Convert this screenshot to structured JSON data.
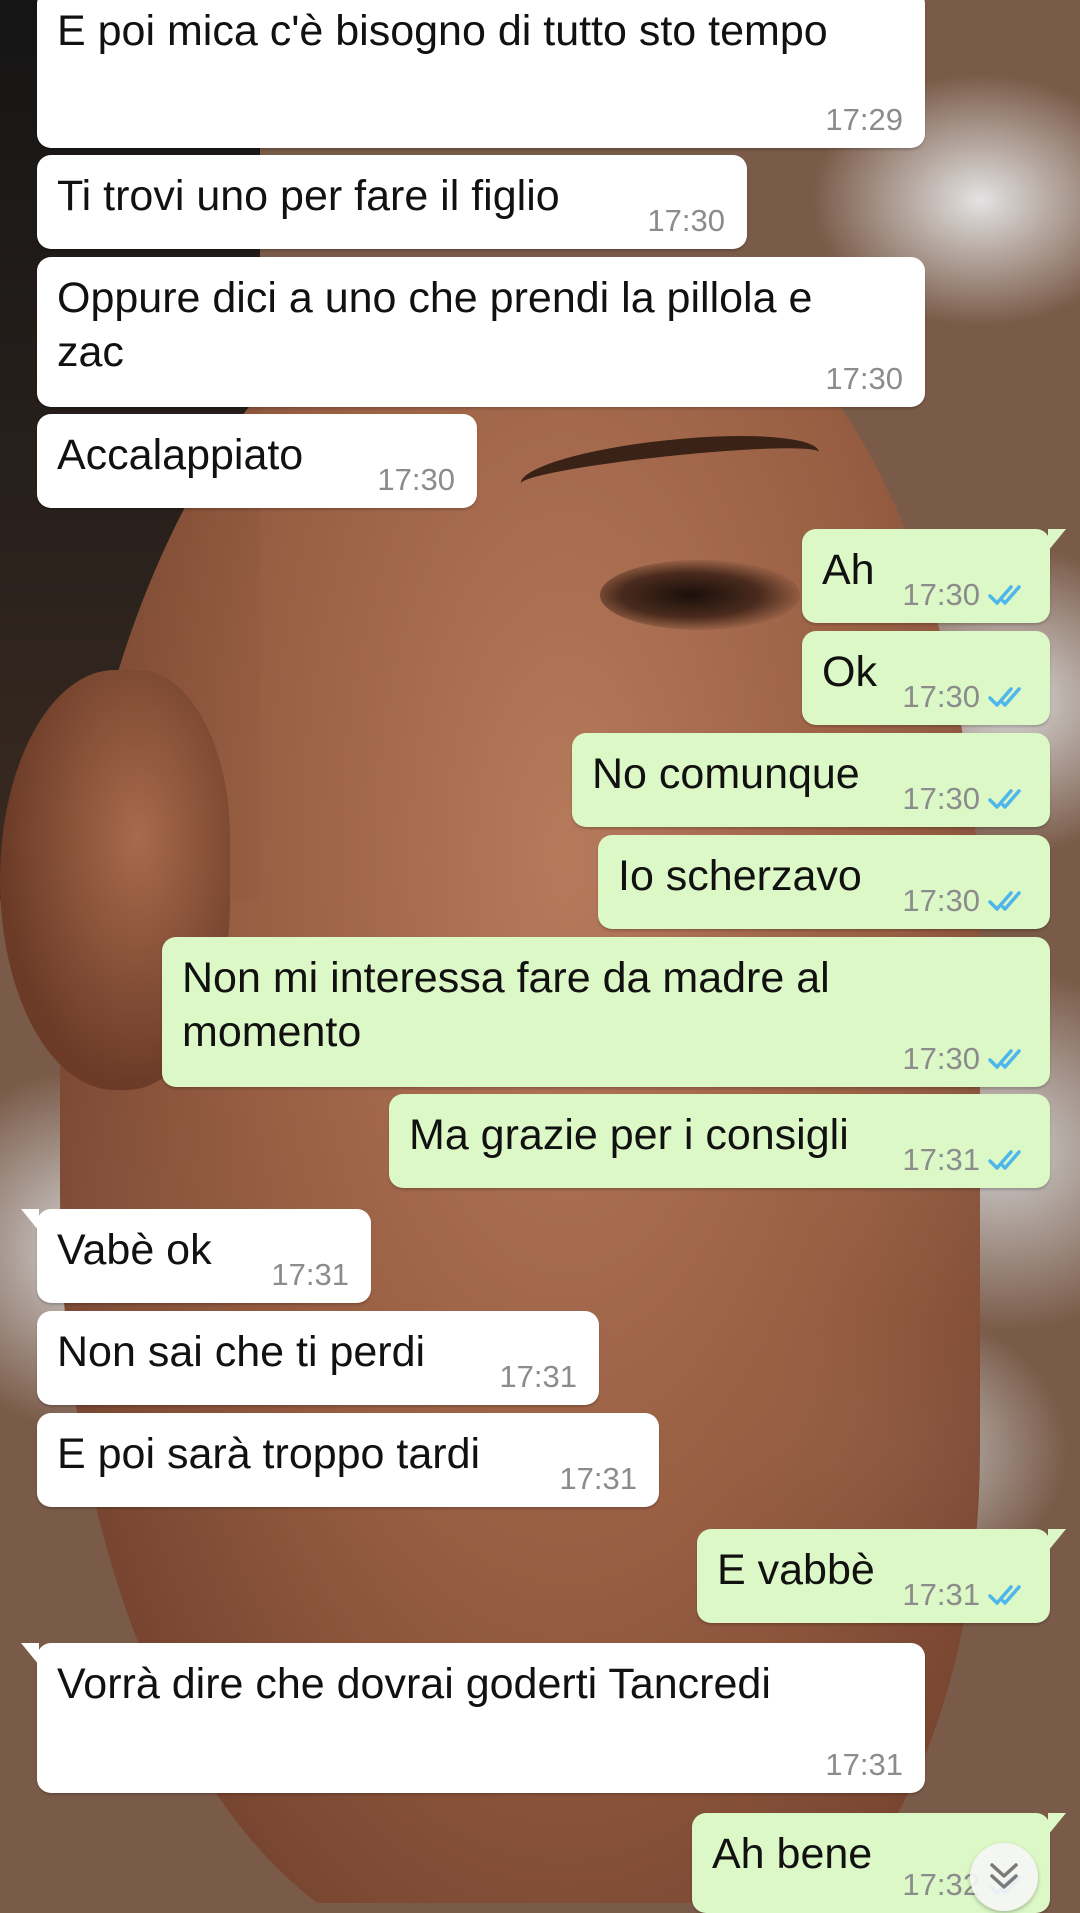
{
  "theme": {
    "incoming": "#ffffff",
    "outgoing": "#dcf8c6",
    "time": "#8c8c8c",
    "read_tick": "#4fb6ec"
  },
  "messages": [
    {
      "dir": "in",
      "text": "E poi mica c'è bisogno di tutto sto tempo",
      "time": "17:29"
    },
    {
      "dir": "in",
      "text": "Ti trovi uno per fare il figlio",
      "time": "17:30"
    },
    {
      "dir": "in",
      "text": "Oppure dici a uno che prendi la pillola e zac",
      "time": "17:30"
    },
    {
      "dir": "in",
      "text": "Accalappiato",
      "time": "17:30"
    },
    {
      "dir": "out",
      "text": "Ah",
      "time": "17:30",
      "status": "read"
    },
    {
      "dir": "out",
      "text": "Ok",
      "time": "17:30",
      "status": "read"
    },
    {
      "dir": "out",
      "text": "No comunque",
      "time": "17:30",
      "status": "read"
    },
    {
      "dir": "out",
      "text": "Io scherzavo",
      "time": "17:30",
      "status": "read"
    },
    {
      "dir": "out",
      "text": "Non mi interessa fare da madre al momento",
      "time": "17:30",
      "status": "read"
    },
    {
      "dir": "out",
      "text": "Ma grazie per i consigli",
      "time": "17:31",
      "status": "read"
    },
    {
      "dir": "in",
      "text": "Vabè ok",
      "time": "17:31"
    },
    {
      "dir": "in",
      "text": "Non sai che ti perdi",
      "time": "17:31"
    },
    {
      "dir": "in",
      "text": "E poi sarà troppo tardi",
      "time": "17:31"
    },
    {
      "dir": "out",
      "text": "E vabbè",
      "time": "17:31",
      "status": "read"
    },
    {
      "dir": "in",
      "text": "Vorrà dire che dovrai goderti Tancredi",
      "time": "17:31"
    },
    {
      "dir": "out",
      "text": "Ah bene",
      "time": "17:32",
      "status": "read"
    }
  ],
  "scroll_button": {
    "icon": "double-chevron-down-icon"
  }
}
